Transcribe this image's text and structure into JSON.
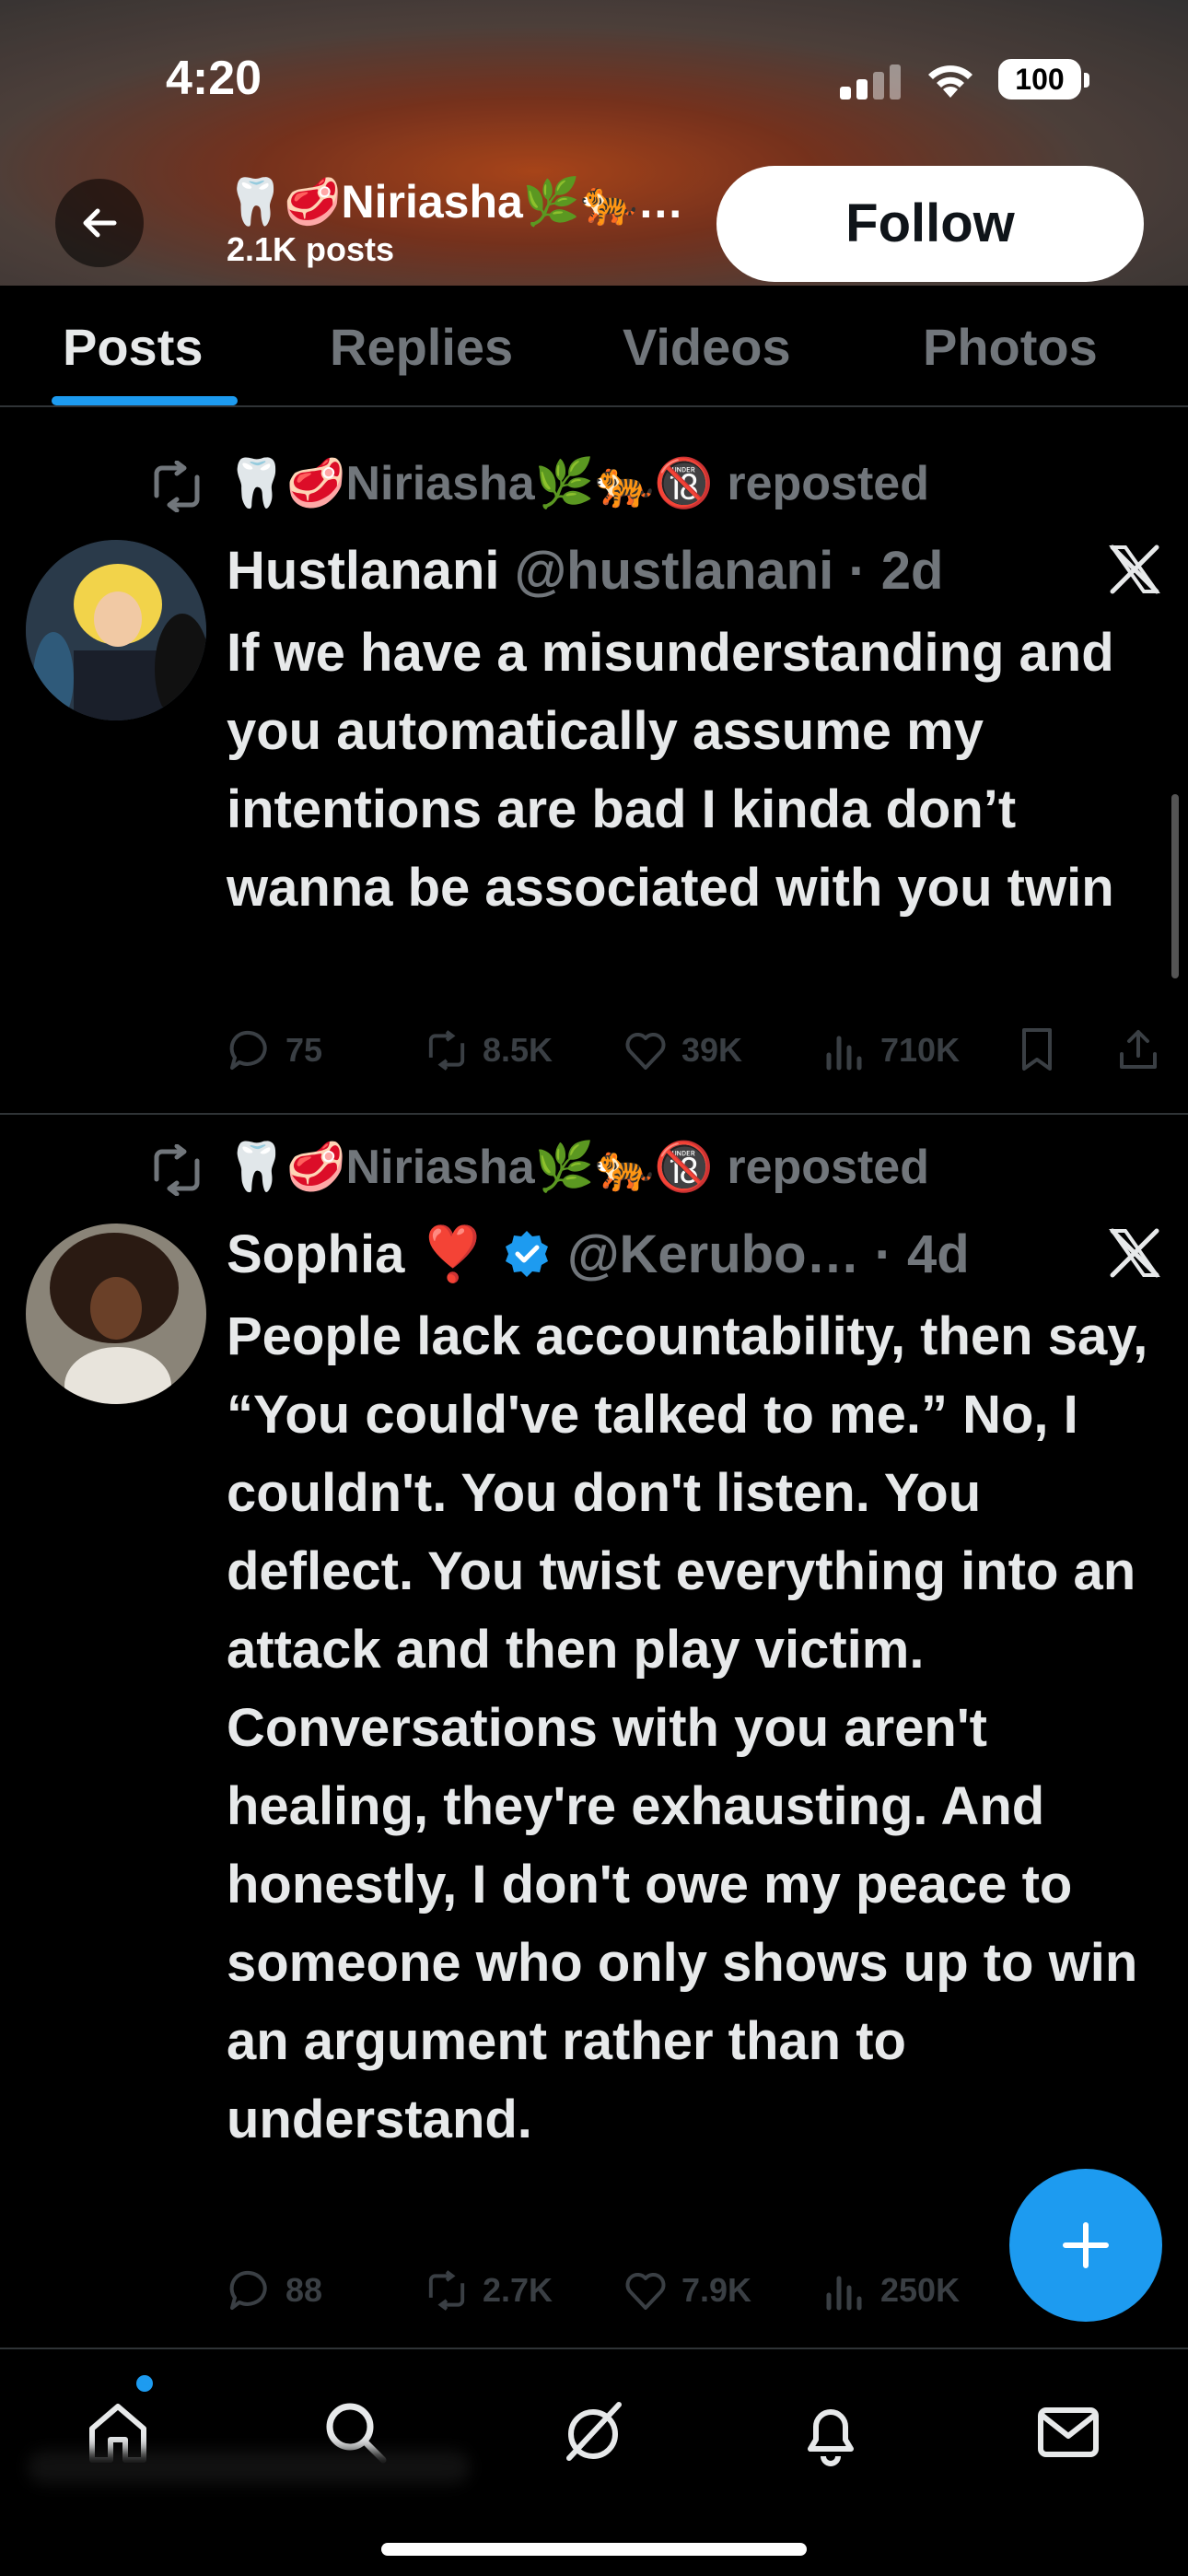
{
  "status_bar": {
    "time": "4:20",
    "battery": "100"
  },
  "header": {
    "profile_name": "🦷🥩Niriasha🌿🐅…",
    "post_count": "2.1K posts",
    "follow_label": "Follow"
  },
  "tabs": [
    {
      "label": "Posts",
      "active": true
    },
    {
      "label": "Replies",
      "active": false
    },
    {
      "label": "Videos",
      "active": false
    },
    {
      "label": "Photos",
      "active": false
    }
  ],
  "posts": [
    {
      "repost_text": "🦷🥩Niriasha🌿🐅🔞 reposted",
      "author_name": "Hustlanani",
      "author_handle": "@hustlanani",
      "time": "· 2d",
      "verified": false,
      "body": "If we have a misunderstanding and you automatically assume my intentions are bad I kinda don’t wanna be associated with you twin",
      "replies": "75",
      "reposts": "8.5K",
      "likes": "39K",
      "views": "710K"
    },
    {
      "repost_text": "🦷🥩Niriasha🌿🐅🔞 reposted",
      "author_name": "Sophia ❣️",
      "author_handle": "@Kerubo…",
      "time": "· 4d",
      "verified": true,
      "body": "People lack accountability, then say, “You could've talked to me.” No, I couldn't. You don't listen. You deflect. You twist everything into an attack and then play victim. Conversations with you aren't healing, they're exhausting. And honestly, I don't owe my peace to someone who only shows up to win an argument rather than to understand.",
      "replies": "88",
      "reposts": "2.7K",
      "likes": "7.9K",
      "views": "250K"
    }
  ],
  "colors": {
    "accent": "#1d9bf0",
    "text": "#e7e9ea",
    "muted": "#71767b",
    "background": "#000000"
  },
  "icons": [
    "back-arrow-icon",
    "repost-icon",
    "x-logo-icon",
    "reply-icon",
    "like-icon",
    "views-icon",
    "bookmark-icon",
    "share-icon",
    "compose-plus-icon",
    "home-icon",
    "search-icon",
    "grok-icon",
    "bell-icon",
    "mail-icon",
    "verified-badge-icon"
  ]
}
